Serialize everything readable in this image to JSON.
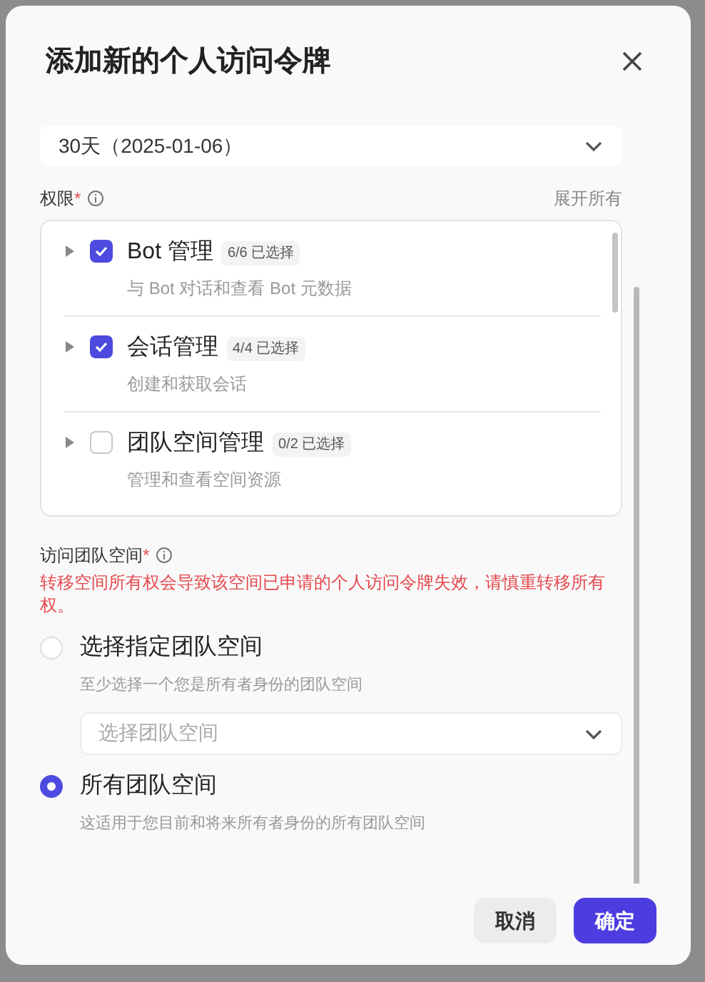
{
  "dialog": {
    "title": "添加新的个人访问令牌"
  },
  "expiry": {
    "value": "30天（2025-01-06）"
  },
  "permissions": {
    "label": "权限",
    "required_mark": "*",
    "expand_all": "展开所有",
    "items": [
      {
        "name": "Bot 管理",
        "count": "6/6 已选择",
        "description": "与 Bot 对话和查看 Bot 元数据",
        "checked": true,
        "expanded": false
      },
      {
        "name": "会话管理",
        "count": "4/4 已选择",
        "description": "创建和获取会话",
        "checked": true,
        "expanded": false
      },
      {
        "name": "团队空间管理",
        "count": "0/2 已选择",
        "description": "管理和查看空间资源",
        "checked": false,
        "expanded": false
      }
    ]
  },
  "workspace_access": {
    "label": "访问团队空间",
    "required_mark": "*",
    "warning": "转移空间所有权会导致该空间已申请的个人访问令牌失效，请慎重转移所有权。",
    "options": [
      {
        "title": "选择指定团队空间",
        "hint": "至少选择一个您是所有者身份的团队空间",
        "selected": false,
        "placeholder": "选择团队空间"
      },
      {
        "title": "所有团队空间",
        "hint": "这适用于您目前和将来所有者身份的所有团队空间",
        "selected": true
      }
    ]
  },
  "buttons": {
    "cancel": "取消",
    "confirm": "确定"
  }
}
